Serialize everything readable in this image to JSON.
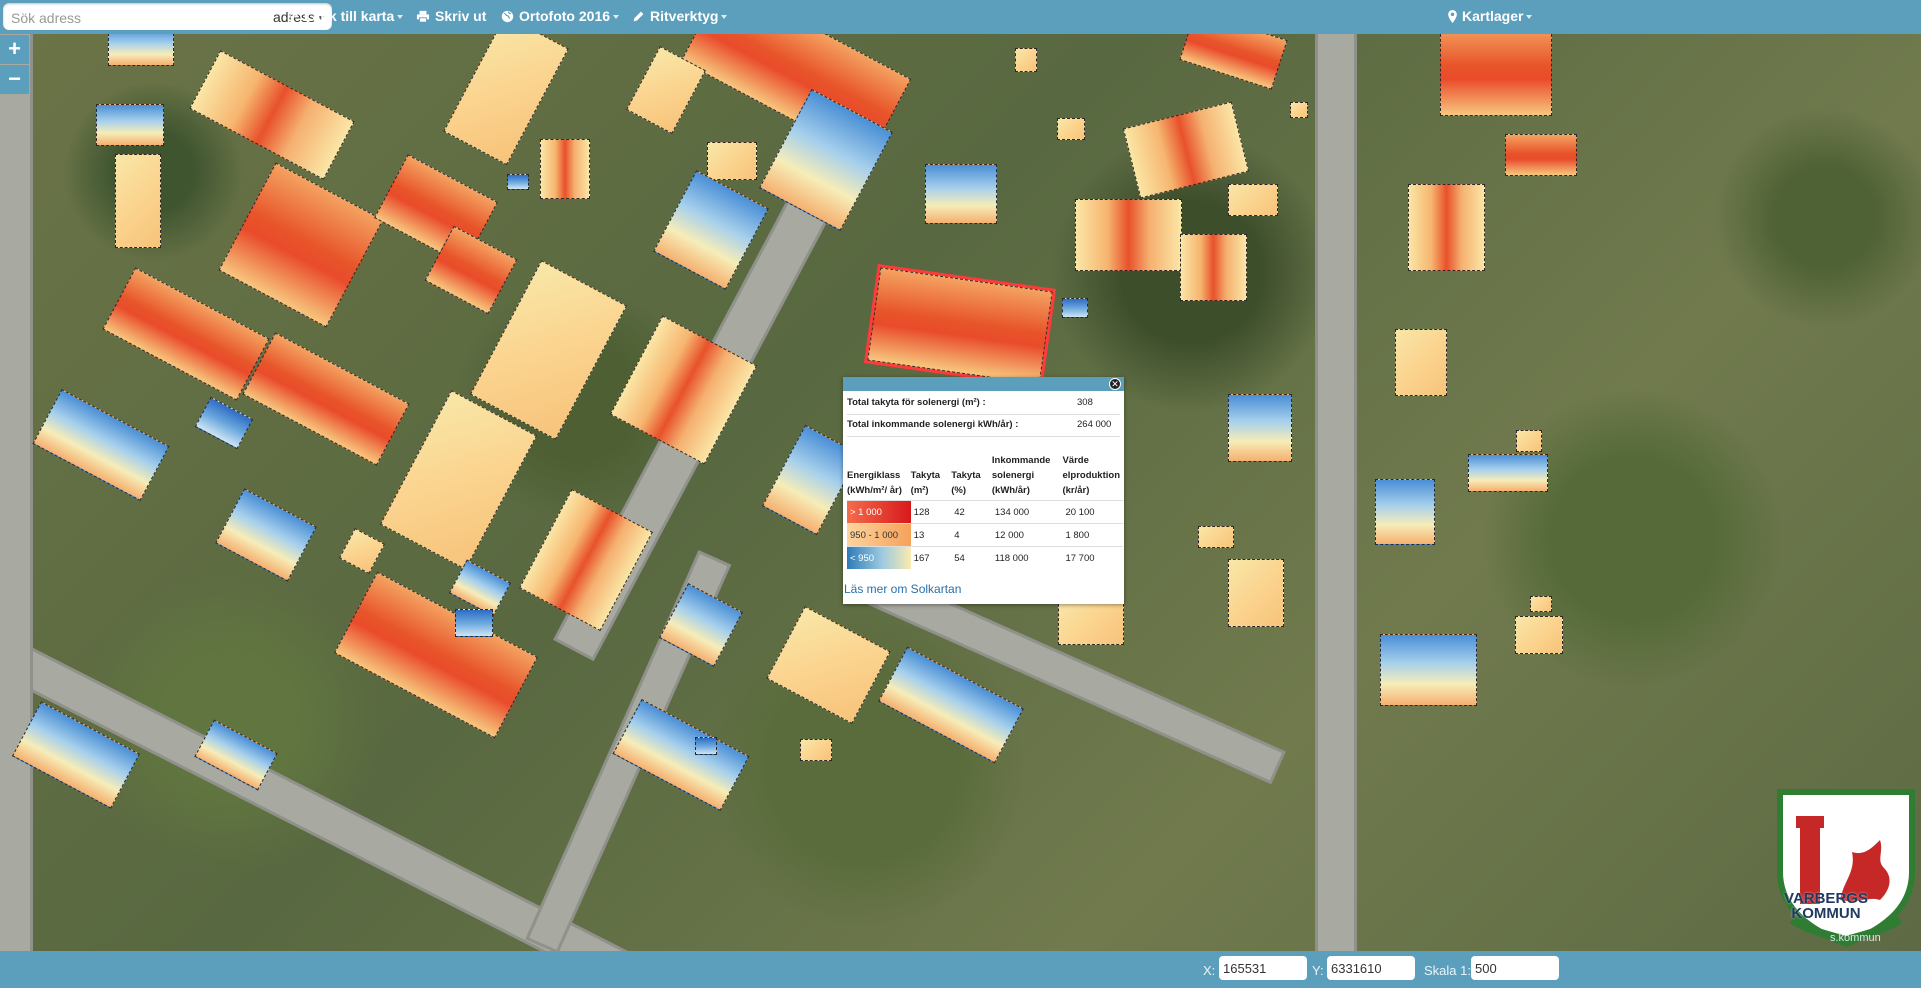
{
  "toolbar": {
    "search_placeholder": "Sök adress",
    "search_mode": "adress",
    "link_map": "Länk till karta",
    "print": "Skriv ut",
    "ortofoto": "Ortofoto 2016",
    "draw_tools": "Ritverktyg",
    "map_layers": "Kartlager"
  },
  "zoom": {
    "in": "+",
    "out": "−"
  },
  "popup": {
    "total_area_label": "Total takyta för solenergi (m²) :",
    "total_area_value": "308",
    "total_energy_label": "Total inkommande solenergi kWh/år) :",
    "total_energy_value": "264 000",
    "headers": [
      "Energiklass (kWh/m²/ år)",
      "Takyta (m²)",
      "Takyta (%)",
      "Inkommande solenergi (kWh/år)",
      "Värde elproduktion (kr/år)"
    ],
    "rows": [
      {
        "class": "> 1 000",
        "area": "128",
        "pct": "42",
        "energy": "134 000",
        "value": "20 100",
        "color": "#d7191c"
      },
      {
        "class": "950 - 1 000",
        "area": "13",
        "pct": "4",
        "energy": "12 000",
        "value": "1 800",
        "color": "#f6a15a"
      },
      {
        "class": "< 950",
        "area": "167",
        "pct": "54",
        "energy": "118 000",
        "value": "17 700",
        "color": "#2c7bb6"
      }
    ],
    "read_more": "Läs mer om Solkartan"
  },
  "coords": {
    "x_label": "X:",
    "x_value": "165531",
    "y_label": "Y:",
    "y_value": "6331610",
    "scale_label": "Skala 1:",
    "scale_value": "500"
  },
  "logo": {
    "line1": "VARBERGS",
    "line2": "KOMMUN",
    "sub": "s.kommun"
  },
  "colors": {
    "toolbar": "#5b9fbd",
    "link": "#2a6fa8",
    "selected_outline": "#ff3a3a"
  }
}
